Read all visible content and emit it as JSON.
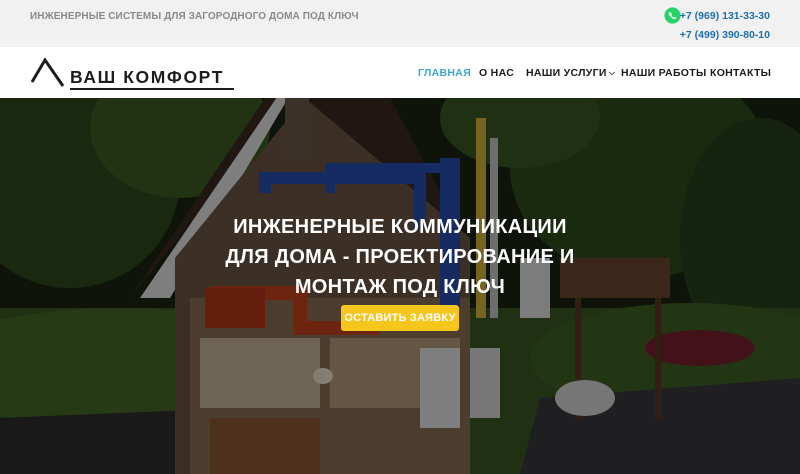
{
  "topbar": {
    "tagline": "ИНЖЕНЕРНЫЕ СИСТЕМЫ ДЛЯ ЗАГОРОДНОГО ДОМА ПОД КЛЮЧ",
    "whatsapp_icon": "whatsapp-icon",
    "phone_1": "+7 (969) 131-33-30",
    "phone_2": "+7 (499) 390-80-10"
  },
  "header": {
    "logo_text": "ВАШ КОМФОРТ",
    "logo_icon": "roof-icon",
    "nav": [
      {
        "label": "ГЛАВНАЯ",
        "active": true
      },
      {
        "label": "О НАС",
        "active": false
      },
      {
        "label": "НАШИ УСЛУГИ",
        "active": false,
        "icon": "chevron-down-icon"
      },
      {
        "label": "НАШИ РАБОТЫ",
        "active": false
      },
      {
        "label": "КОНТАКТЫ",
        "active": false
      }
    ]
  },
  "hero": {
    "title_lines": [
      "ИНЖЕНЕРНЫЕ КОММУНИКАЦИИ",
      "ДЛЯ ДОМА - ПРОЕКТИРОВАНИЕ И",
      "МОНТАЖ ПОД КЛЮЧ"
    ],
    "cta_label": "ОСТАВИТЬ ЗАЯВКУ"
  },
  "colors": {
    "accent": "#3aa6d6",
    "phone": "#1f6fb2",
    "cta": "#f6c61c",
    "whatsapp": "#25d366",
    "topbar_bg": "#f1f1f1"
  }
}
